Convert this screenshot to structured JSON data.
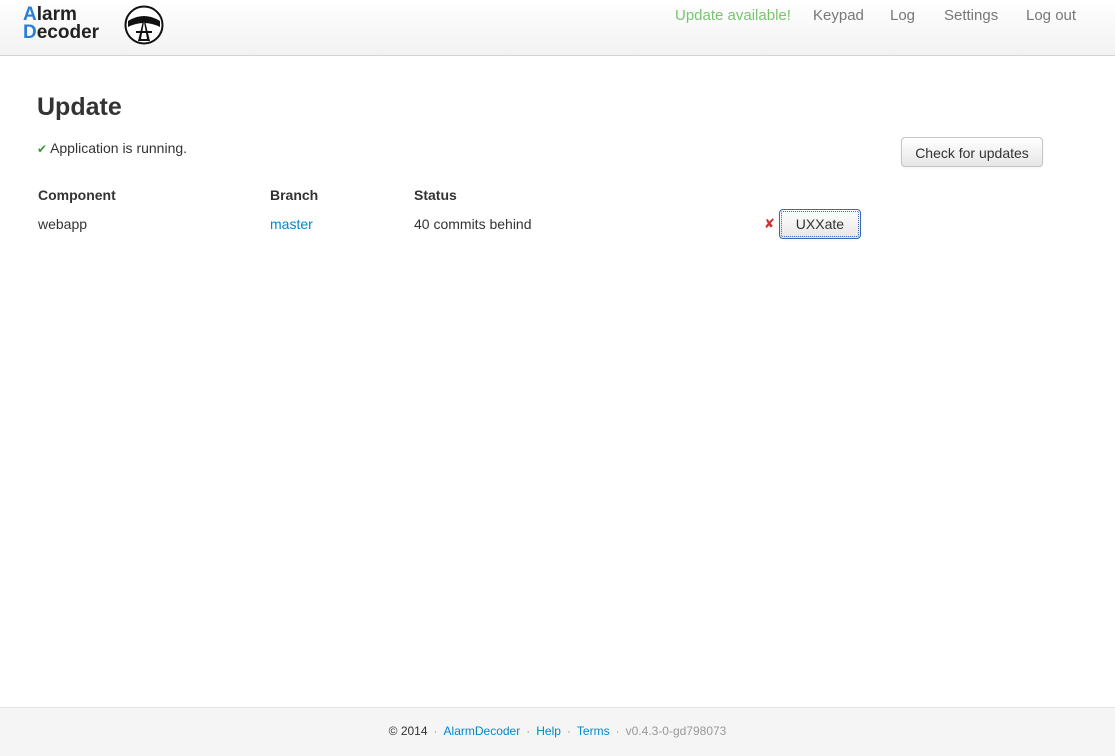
{
  "app": {
    "logo_line1_accent": "A",
    "logo_line1_rest": "larm",
    "logo_line2_accent": "D",
    "logo_line2_rest": "ecoder"
  },
  "nav": {
    "items": [
      {
        "label": "Update available!",
        "color": "#77c56f"
      },
      {
        "label": "Keypad"
      },
      {
        "label": "Log"
      },
      {
        "label": "Settings"
      },
      {
        "label": "Log out"
      }
    ]
  },
  "main": {
    "title": "Update",
    "status_icon": "check-icon",
    "status_text": "Application is running.",
    "check_button_label": "Check for updates",
    "table": {
      "headers": [
        "Component",
        "Branch",
        "Status"
      ],
      "rows": [
        {
          "component": "webapp",
          "branch": "master",
          "status": "40 commits behind",
          "error_icon": "x-icon",
          "update_button_label": "UXXate"
        }
      ]
    }
  },
  "footer": {
    "copyright": "© 2014",
    "links": [
      "AlarmDecoder",
      "Help",
      "Terms"
    ],
    "separator": "·",
    "version": "v0.4.3-0-gd798073"
  },
  "colors": {
    "accent_blue": "#2a7fd4",
    "link_blue": "#0088cc",
    "update_green": "#77c56f",
    "check_green": "#3a9a3a",
    "error_red": "#d33030"
  }
}
